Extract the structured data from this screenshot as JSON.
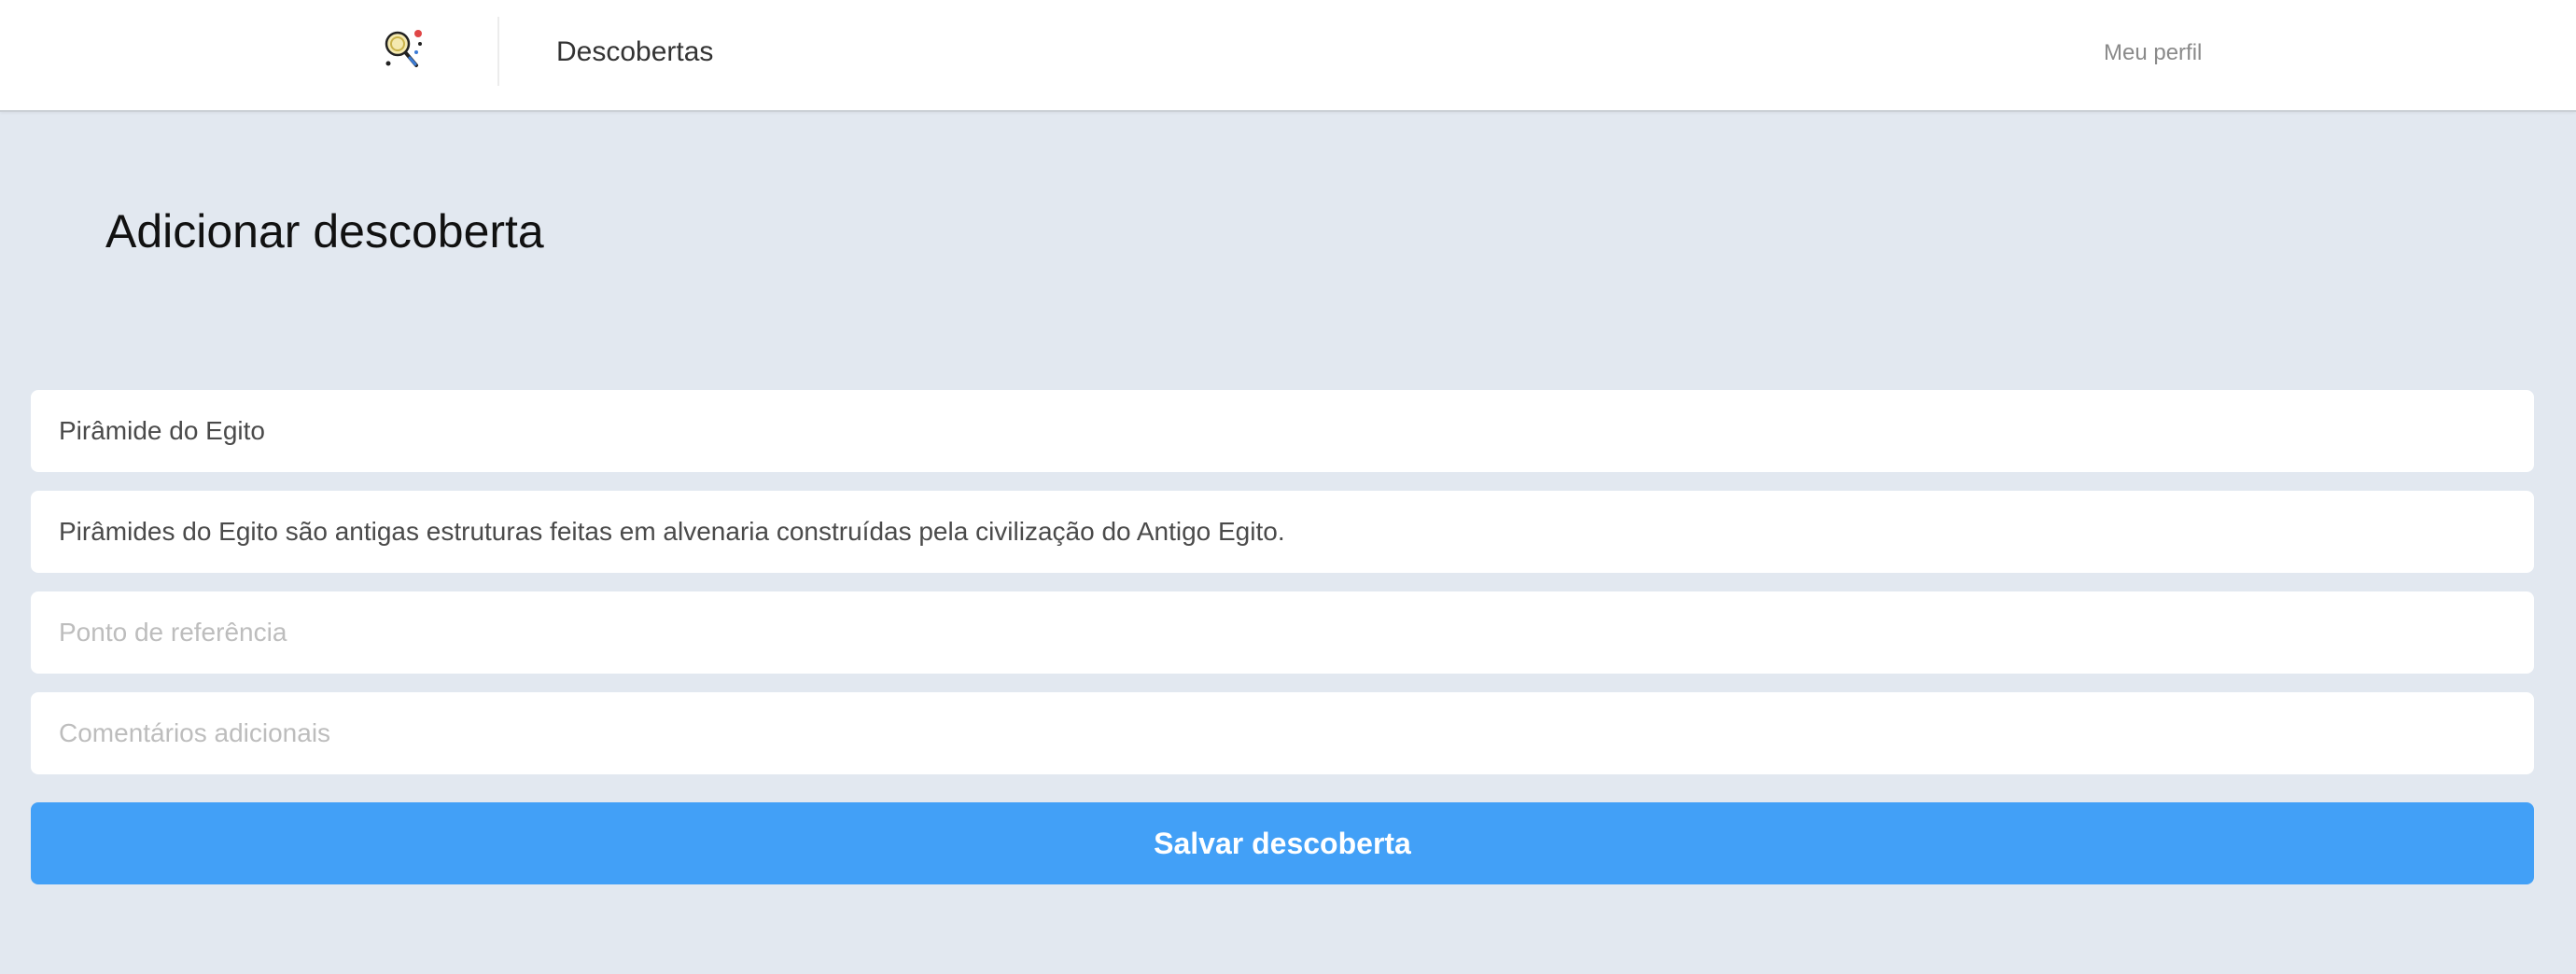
{
  "navbar": {
    "logo_icon": "magnifier-discovery-icon",
    "title": "Descobertas",
    "profile_link": "Meu perfil"
  },
  "page": {
    "title": "Adicionar descoberta"
  },
  "form": {
    "name": {
      "value": "Pirâmide do Egito",
      "placeholder": ""
    },
    "description": {
      "value": "Pirâmides do Egito são antigas estruturas feitas em alvenaria construídas pela civilização do Antigo Egito.",
      "placeholder": ""
    },
    "reference": {
      "value": "",
      "placeholder": "Ponto de referência"
    },
    "comments": {
      "value": "",
      "placeholder": "Comentários adicionais"
    },
    "submit_label": "Salvar descoberta"
  },
  "colors": {
    "background": "#e2e8f0",
    "navbar": "#ffffff",
    "primary_button": "#42a0f7",
    "placeholder": "#bdbdbd"
  }
}
